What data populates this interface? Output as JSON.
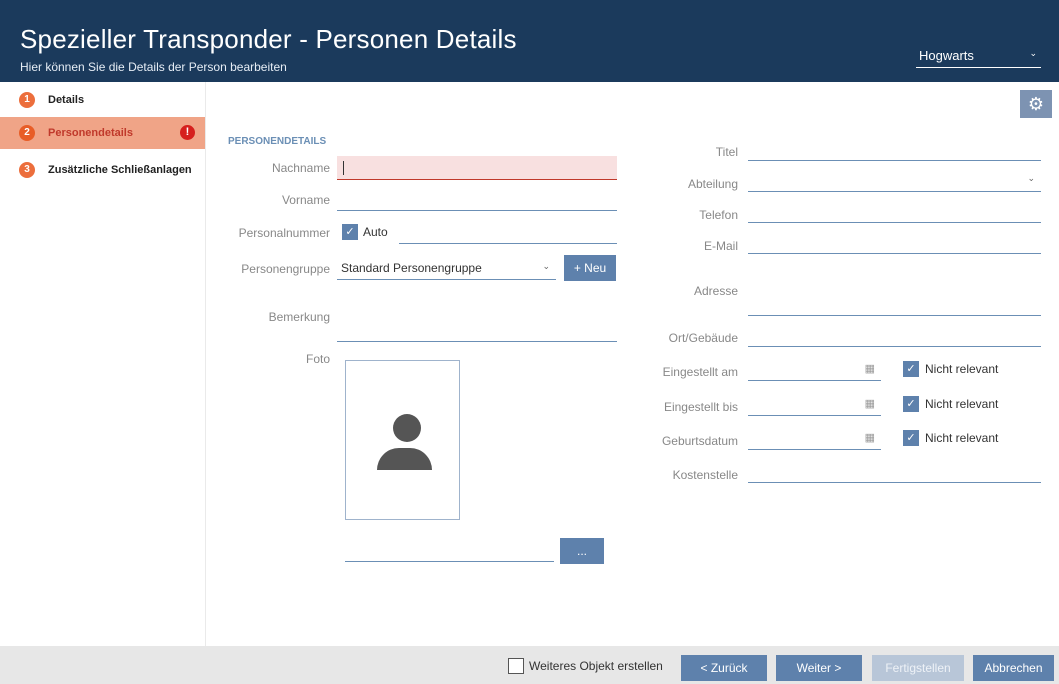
{
  "header": {
    "title": "Spezieller Transponder - Personen Details",
    "subtitle": "Hier können Sie die Details der Person bearbeiten",
    "site_selector": "Hogwarts"
  },
  "steps": [
    {
      "num": "1",
      "label": "Details"
    },
    {
      "num": "2",
      "label": "Personendetails"
    },
    {
      "num": "3",
      "label": "Zusätzliche Schließanlagen"
    }
  ],
  "section_title": "PERSONENDETAILS",
  "left_form": {
    "nachname_label": "Nachname",
    "nachname_value": "",
    "vorname_label": "Vorname",
    "vorname_value": "",
    "personalnummer_label": "Personalnummer",
    "auto_label": "Auto",
    "personalnummer_value": "",
    "personengruppe_label": "Personengruppe",
    "personengruppe_value": "Standard Personengruppe",
    "new_button": "+ Neu",
    "bemerkung_label": "Bemerkung",
    "bemerkung_value": "",
    "foto_label": "Foto",
    "foto_path_value": "",
    "browse_button": "..."
  },
  "right_form": {
    "titel_label": "Titel",
    "abteilung_label": "Abteilung",
    "telefon_label": "Telefon",
    "email_label": "E-Mail",
    "adresse_label": "Adresse",
    "ort_label": "Ort/Gebäude",
    "eingestellt_am_label": "Eingestellt am",
    "eingestellt_bis_label": "Eingestellt bis",
    "geburtsdatum_label": "Geburtsdatum",
    "kostenstelle_label": "Kostenstelle",
    "nicht_relevant": "Nicht relevant"
  },
  "footer": {
    "create_more_label": "Weiteres Objekt erstellen",
    "back_button": "< Zurück",
    "next_button": "Weiter >",
    "finish_button": "Fertigstellen",
    "cancel_button": "Abbrechen"
  },
  "colors": {
    "header_bg": "#1b3a5c",
    "accent": "#5e81ac",
    "step_badge": "#ec6e3c",
    "active_step_bg": "#f0a487",
    "error": "#d6201d"
  }
}
